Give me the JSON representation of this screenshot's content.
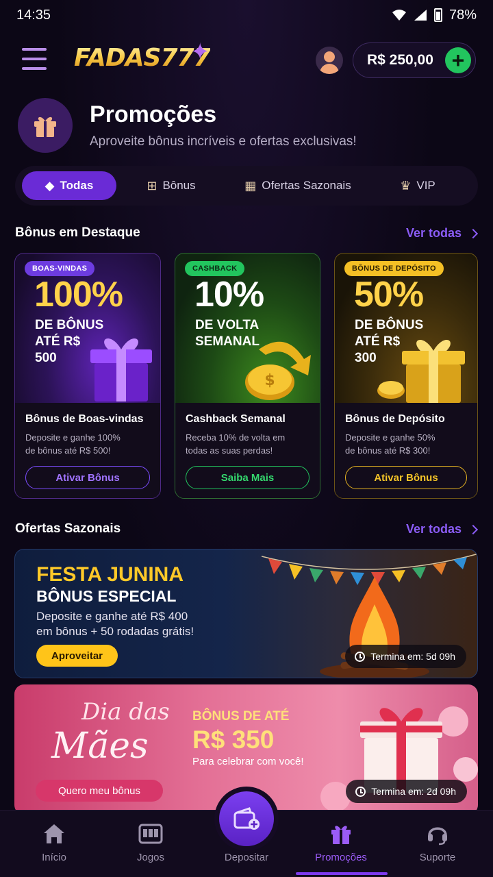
{
  "status": {
    "time": "14:35",
    "battery": "78%"
  },
  "header": {
    "brand": "FADAS777",
    "balance": "R$ 250,00"
  },
  "page": {
    "title": "Promoções",
    "subtitle": "Aproveite bônus incríveis e ofertas exclusivas!"
  },
  "tabs": [
    {
      "label": "Todas",
      "icon": "tag-icon",
      "active": true
    },
    {
      "label": "Bônus",
      "icon": "gift-icon",
      "active": false
    },
    {
      "label": "Ofertas Sazonais",
      "icon": "calendar-icon",
      "active": false
    },
    {
      "label": "VIP",
      "icon": "crown-icon",
      "active": false
    }
  ],
  "featured": {
    "title": "Bônus em Destaque",
    "see_all": "Ver todas",
    "cards": [
      {
        "badge": "BOAS-VINDAS",
        "big": "100%",
        "mid": "DE BÔNUS\nATÉ R$\n500",
        "name": "Bônus de Boas-vindas",
        "desc": "Deposite e ganhe 100%\nde bônus até R$ 500!",
        "cta": "Ativar Bônus",
        "accent": "#7c4dff"
      },
      {
        "badge": "CASHBACK",
        "big": "10%",
        "mid": "DE VOLTA\nSEMANAL",
        "name": "Cashback Semanal",
        "desc": "Receba 10% de volta em\ntodas as suas perdas!",
        "cta": "Saiba Mais",
        "accent": "#22c55e"
      },
      {
        "badge": "BÔNUS DE DEPÓSITO",
        "big": "50%",
        "mid": "DE BÔNUS\nATÉ R$\n300",
        "name": "Bônus de Depósito",
        "desc": "Deposite e ganhe 50%\nde bônus até R$ 300!",
        "cta": "Ativar Bônus",
        "accent": "#f5c025"
      }
    ]
  },
  "seasonal": {
    "title": "Ofertas Sazonais",
    "see_all": "Ver todas",
    "banners": [
      {
        "title": "FESTA JUNINA",
        "subtitle": "BÔNUS ESPECIAL",
        "text": "Deposite e ganhe até R$ 400\nem bônus + 50 rodadas grátis!",
        "cta": "Aproveitar",
        "ends": "Termina em: 5d 09h"
      },
      {
        "script_line1": "Dia das",
        "script_line2": "Mães",
        "title": "BÔNUS DE ATÉ",
        "amount": "R$ 350",
        "text": "Para celebrar com você!",
        "cta": "Quero meu bônus",
        "ends": "Termina em: 2d 09h"
      }
    ]
  },
  "nav": [
    {
      "label": "Início",
      "icon": "home-icon",
      "active": false
    },
    {
      "label": "Jogos",
      "icon": "slot-machine-icon",
      "active": false
    },
    {
      "label": "Depositar",
      "icon": "wallet-add-icon",
      "active": false
    },
    {
      "label": "Promoções",
      "icon": "gift-icon",
      "active": true
    },
    {
      "label": "Suporte",
      "icon": "headset-icon",
      "active": false
    }
  ]
}
